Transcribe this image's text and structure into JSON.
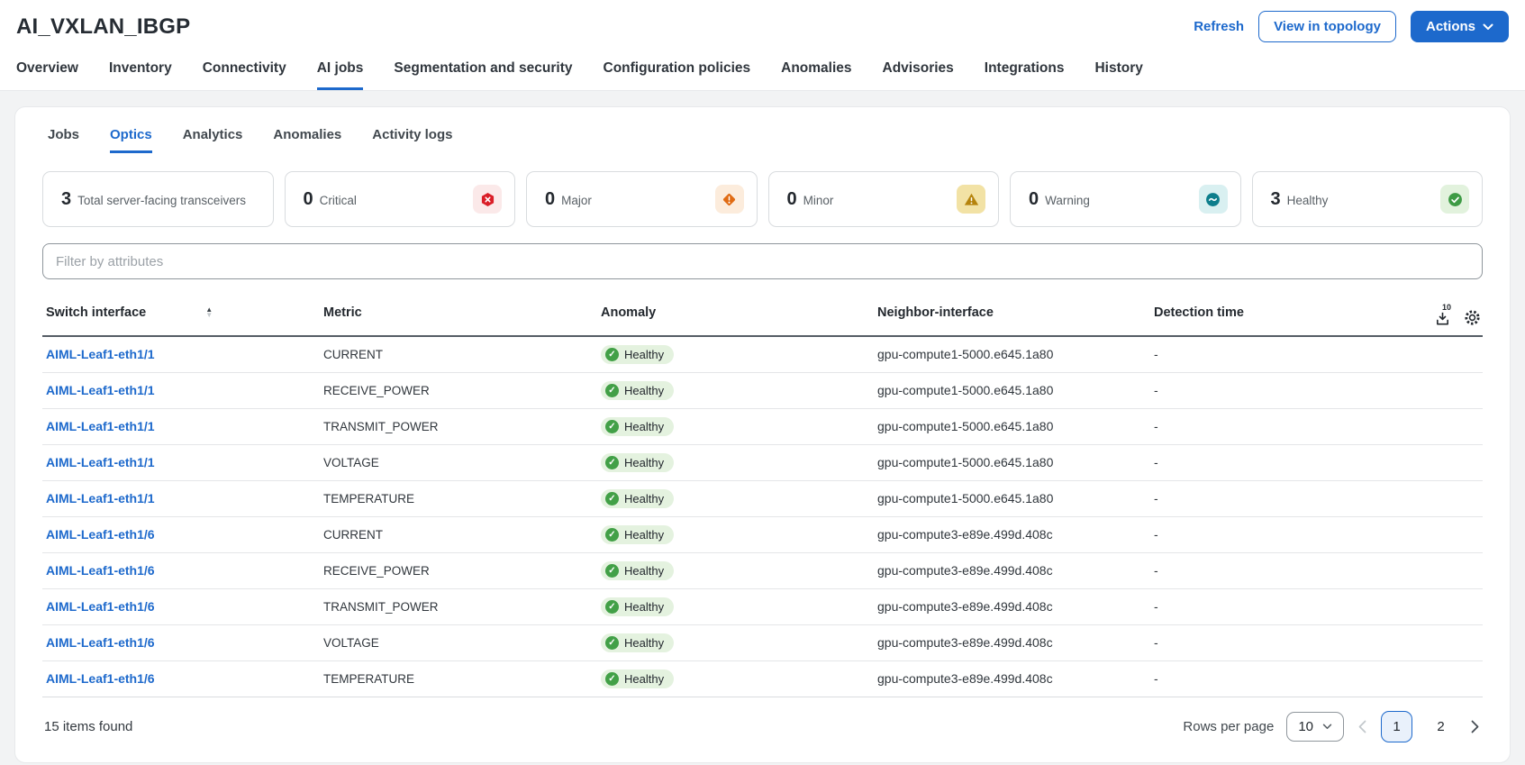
{
  "page": {
    "title": "AI_VXLAN_IBGP",
    "refresh_label": "Refresh",
    "view_in_topology_label": "View in topology",
    "actions_label": "Actions"
  },
  "nav_tabs": {
    "items": [
      {
        "label": "Overview",
        "active": false
      },
      {
        "label": "Inventory",
        "active": false
      },
      {
        "label": "Connectivity",
        "active": false
      },
      {
        "label": "AI jobs",
        "active": true
      },
      {
        "label": "Segmentation and security",
        "active": false
      },
      {
        "label": "Configuration policies",
        "active": false
      },
      {
        "label": "Anomalies",
        "active": false
      },
      {
        "label": "Advisories",
        "active": false
      },
      {
        "label": "Integrations",
        "active": false
      },
      {
        "label": "History",
        "active": false
      }
    ]
  },
  "sub_tabs": {
    "items": [
      {
        "label": "Jobs",
        "active": false
      },
      {
        "label": "Optics",
        "active": true
      },
      {
        "label": "Analytics",
        "active": false
      },
      {
        "label": "Anomalies",
        "active": false
      },
      {
        "label": "Activity logs",
        "active": false
      }
    ]
  },
  "summary_cards": [
    {
      "count": "3",
      "label": "Total server-facing transceivers",
      "icon": null
    },
    {
      "count": "0",
      "label": "Critical",
      "icon": "critical-hexagon-x-icon",
      "icon_color": "#da1e28",
      "icon_bg": "#fbe9e9"
    },
    {
      "count": "0",
      "label": "Major",
      "icon": "major-diamond-exclamation-icon",
      "icon_color": "#e06b13",
      "icon_bg": "#fcecdc"
    },
    {
      "count": "0",
      "label": "Minor",
      "icon": "minor-triangle-exclamation-icon",
      "icon_color": "#b5830c",
      "icon_bg": "#f2e2a5"
    },
    {
      "count": "0",
      "label": "Warning",
      "icon": "warning-tilde-circle-icon",
      "icon_color": "#0d7e8c",
      "icon_bg": "#d9f0f1"
    },
    {
      "count": "3",
      "label": "Healthy",
      "icon": "healthy-check-circle-icon",
      "icon_color": "#3e9b45",
      "icon_bg": "#e2f2dd"
    }
  ],
  "filter": {
    "placeholder": "Filter by attributes"
  },
  "table": {
    "columns": {
      "switch_interface": "Switch interface",
      "metric": "Metric",
      "anomaly": "Anomaly",
      "neighbor_interface": "Neighbor-interface",
      "detection_time": "Detection time"
    },
    "sort": {
      "column": "Switch interface",
      "direction": "ascending"
    },
    "export_badge": "10",
    "rows": [
      {
        "switch_interface": "AIML-Leaf1-eth1/1",
        "metric": "CURRENT",
        "anomaly": "Healthy",
        "neighbor_interface": "gpu-compute1-5000.e645.1a80",
        "detection_time": "-"
      },
      {
        "switch_interface": "AIML-Leaf1-eth1/1",
        "metric": "RECEIVE_POWER",
        "anomaly": "Healthy",
        "neighbor_interface": "gpu-compute1-5000.e645.1a80",
        "detection_time": "-"
      },
      {
        "switch_interface": "AIML-Leaf1-eth1/1",
        "metric": "TRANSMIT_POWER",
        "anomaly": "Healthy",
        "neighbor_interface": "gpu-compute1-5000.e645.1a80",
        "detection_time": "-"
      },
      {
        "switch_interface": "AIML-Leaf1-eth1/1",
        "metric": "VOLTAGE",
        "anomaly": "Healthy",
        "neighbor_interface": "gpu-compute1-5000.e645.1a80",
        "detection_time": "-"
      },
      {
        "switch_interface": "AIML-Leaf1-eth1/1",
        "metric": "TEMPERATURE",
        "anomaly": "Healthy",
        "neighbor_interface": "gpu-compute1-5000.e645.1a80",
        "detection_time": "-"
      },
      {
        "switch_interface": "AIML-Leaf1-eth1/6",
        "metric": "CURRENT",
        "anomaly": "Healthy",
        "neighbor_interface": "gpu-compute3-e89e.499d.408c",
        "detection_time": "-"
      },
      {
        "switch_interface": "AIML-Leaf1-eth1/6",
        "metric": "RECEIVE_POWER",
        "anomaly": "Healthy",
        "neighbor_interface": "gpu-compute3-e89e.499d.408c",
        "detection_time": "-"
      },
      {
        "switch_interface": "AIML-Leaf1-eth1/6",
        "metric": "TRANSMIT_POWER",
        "anomaly": "Healthy",
        "neighbor_interface": "gpu-compute3-e89e.499d.408c",
        "detection_time": "-"
      },
      {
        "switch_interface": "AIML-Leaf1-eth1/6",
        "metric": "VOLTAGE",
        "anomaly": "Healthy",
        "neighbor_interface": "gpu-compute3-e89e.499d.408c",
        "detection_time": "-"
      },
      {
        "switch_interface": "AIML-Leaf1-eth1/6",
        "metric": "TEMPERATURE",
        "anomaly": "Healthy",
        "neighbor_interface": "gpu-compute3-e89e.499d.408c",
        "detection_time": "-"
      }
    ]
  },
  "footer": {
    "items_found": "15 items found",
    "rows_per_page_label": "Rows per page",
    "rows_per_page_value": "10",
    "pages": {
      "p1": "1",
      "p2": "2"
    },
    "current_page": "1"
  },
  "colors": {
    "accent_blue": "#1d69cc",
    "critical_red": "#da1e28",
    "major_orange": "#e06b13",
    "minor_amber": "#b5830c",
    "warning_teal": "#0d7e8c",
    "healthy_green": "#3e9b45",
    "healthy_badge_bg": "#e4f2df"
  }
}
